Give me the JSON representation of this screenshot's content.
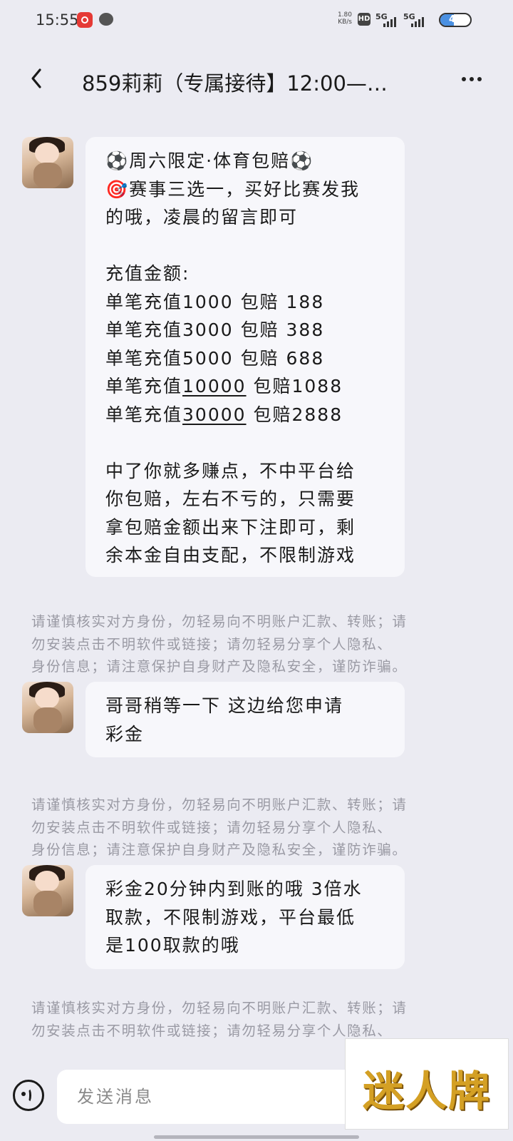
{
  "status_bar": {
    "time": "15:55",
    "speed_value": "1.80",
    "speed_unit": "KB/s",
    "hd": "HD",
    "sim1": "5G",
    "sim2": "5G",
    "battery": "46",
    "battery_level": 0.46
  },
  "header": {
    "title": "859莉莉（专属接待】12:00—…"
  },
  "messages": [
    {
      "lines": [
        "⚽周六限定·体育包赔⚽",
        "🎯赛事三选一，买好比赛发我",
        "的哦，凌晨的留言即可",
        "",
        "充值金额:",
        "单笔充值1000 包赔 188",
        "单笔充值3000 包赔 388",
        "单笔充值5000 包赔 688",
        "单笔充值10000 包赔1088",
        "单笔充值30000 包赔2888",
        "",
        "中了你就多赚点，不中平台给",
        "你包赔，左右不亏的，只需要",
        "拿包赔金额出来下注即可，剩",
        "余本金自由支配，不限制游戏"
      ]
    },
    {
      "lines": [
        "哥哥稍等一下  这边给您申请",
        "彩金"
      ]
    },
    {
      "lines": [
        "彩金20分钟内到账的哦 3倍水",
        "取款，不限制游戏，平台最低",
        "是100取款的哦"
      ]
    }
  ],
  "warning": {
    "line1": "请谨慎核实对方身份，勿轻易向不明账户汇款、转账；请",
    "line2": "勿安装点击不明软件或链接；请勿轻易分享个人隐私、",
    "line3": "身份信息；请注意保护自身财产及隐私安全，谨防诈骗。"
  },
  "input": {
    "placeholder": "发送消息"
  },
  "watermark": {
    "text": "迷人牌"
  }
}
